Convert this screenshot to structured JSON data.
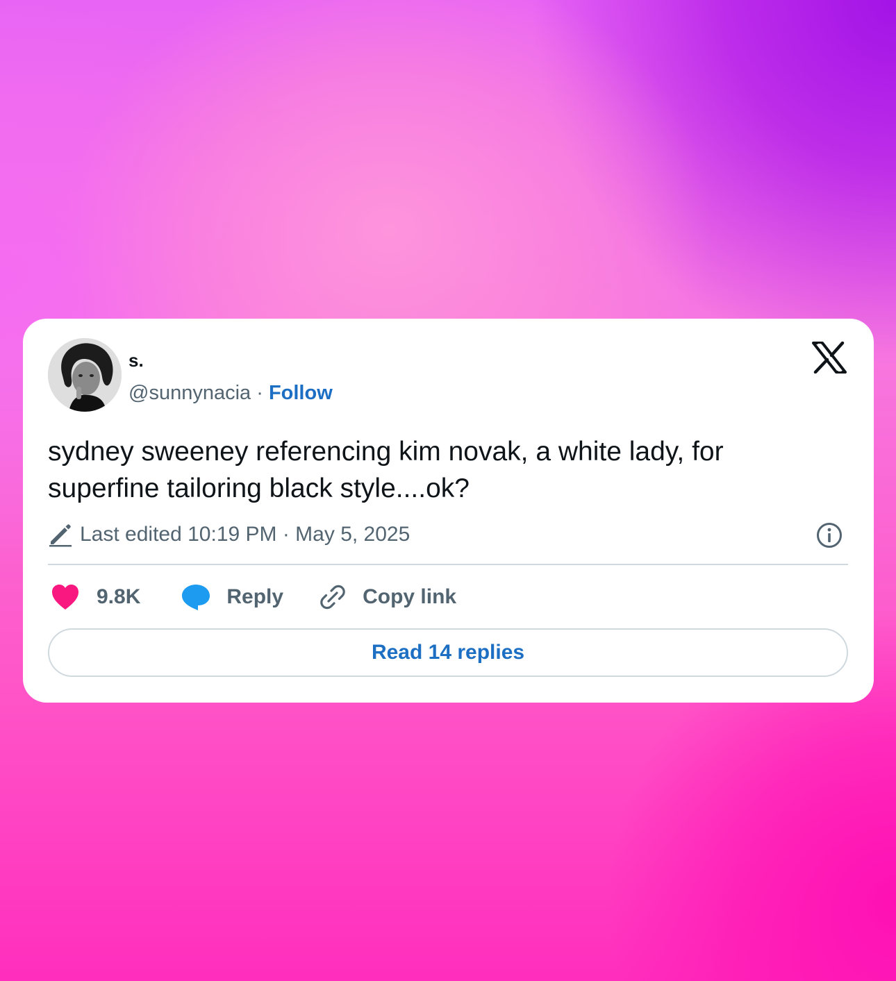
{
  "colors": {
    "accent": "#1d6fc4",
    "like": "#f91880",
    "reply_icon": "#1d9bf0",
    "text_primary": "#0f1419",
    "text_secondary": "#536471",
    "divider": "#cfd9de"
  },
  "tweet": {
    "author": {
      "display_name": "s.",
      "handle": "@sunnynacia",
      "separator": " · ",
      "follow_label": "Follow",
      "avatar_icon": "profile-photo"
    },
    "platform_icon": "x-logo-icon",
    "text_line1": "sydney sweeney referencing kim novak, a white lady, for",
    "text_line2": "superfine tailoring black style....ok?",
    "edited": {
      "icon": "pencil-icon",
      "label": "Last edited 10:19 PM · May 5, 2025"
    },
    "info_icon": "info-icon",
    "actions": {
      "likes": "9.8K",
      "reply_label": "Reply",
      "copy_link_label": "Copy link"
    },
    "read_replies_label": "Read 14 replies"
  }
}
